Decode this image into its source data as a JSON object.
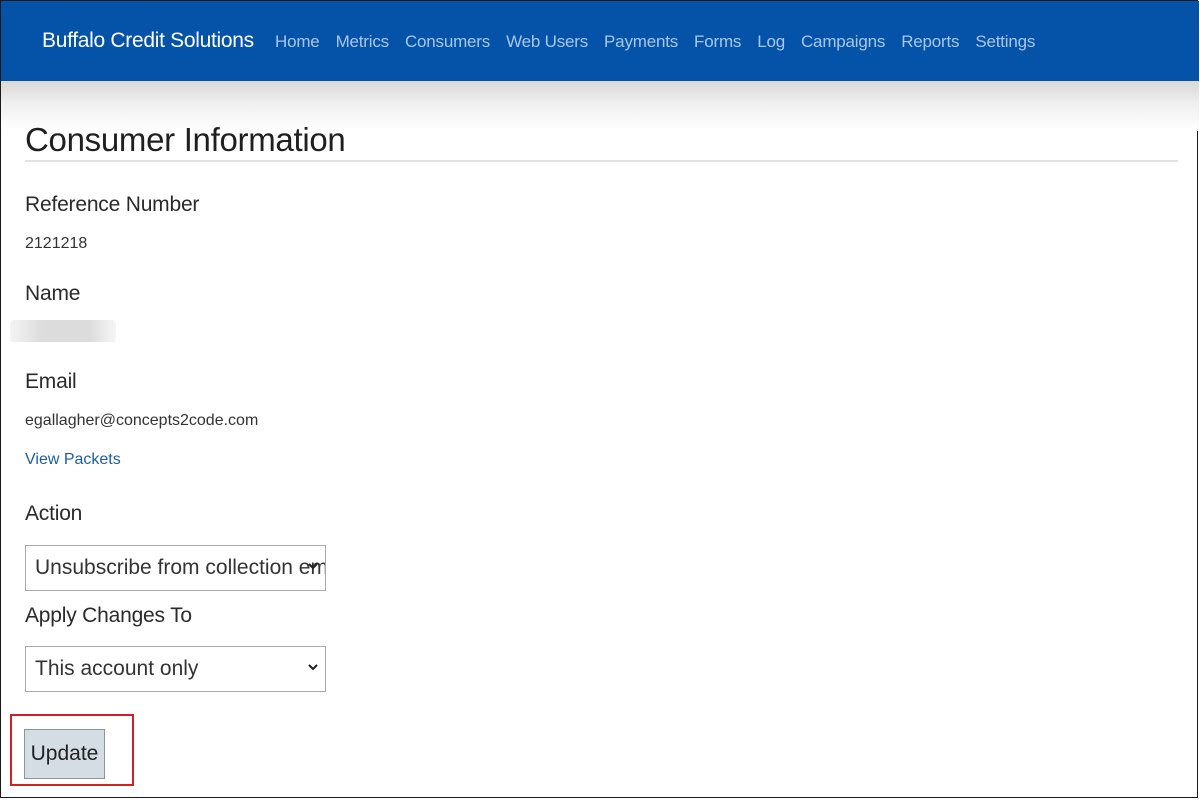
{
  "nav": {
    "brand": "Buffalo Credit Solutions",
    "links": [
      "Home",
      "Metrics",
      "Consumers",
      "Web Users",
      "Payments",
      "Forms",
      "Log",
      "Campaigns",
      "Reports",
      "Settings"
    ],
    "bg_color": "#0453a8"
  },
  "page": {
    "title": "Consumer Information"
  },
  "fields": {
    "reference_label": "Reference Number",
    "reference_value": "2121218",
    "name_label": "Name",
    "email_label": "Email",
    "email_value": "egallagher@concepts2code.com",
    "view_packets_link": "View Packets"
  },
  "form": {
    "action_label": "Action",
    "action_selected": "Unsubscribe from collection emails",
    "apply_label": "Apply Changes To",
    "apply_selected": "This account only",
    "update_label": "Update",
    "highlight_color": "#d11f2a"
  }
}
